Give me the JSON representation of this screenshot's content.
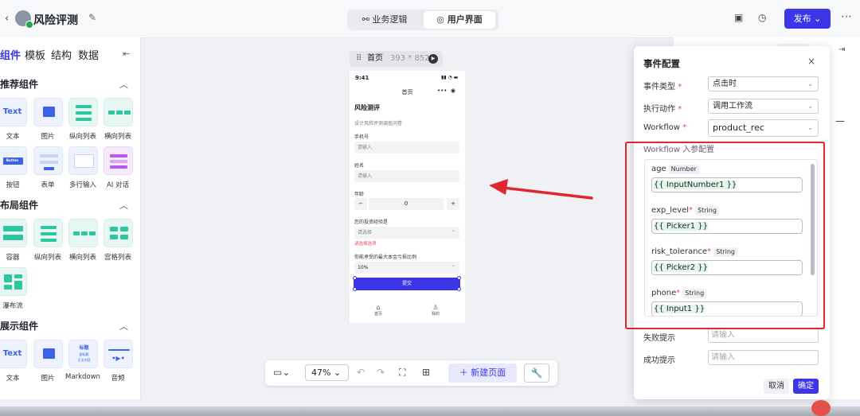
{
  "app": {
    "title": "风险评测"
  },
  "header": {
    "seg_logic": "业务逻辑",
    "seg_ui": "用户界面",
    "publish": "发布"
  },
  "left": {
    "tabs": [
      "组件",
      "模板",
      "结构",
      "数据"
    ],
    "sections": {
      "recommend": "推荐组件",
      "layout": "布局组件",
      "display": "展示组件"
    },
    "recommend_items": [
      "文本",
      "图片",
      "纵向列表",
      "横向列表",
      "按钮",
      "表单",
      "多行输入",
      "AI 对话"
    ],
    "layout_items": [
      "容器",
      "纵向列表",
      "横向列表",
      "宫格列表",
      "瀑布流"
    ],
    "display_items": [
      "文本",
      "图片",
      "Markdown",
      "音频"
    ],
    "tile_text": "Text",
    "button_tile": "Button",
    "md_tile": [
      "标题",
      "副标题",
      "正文内容"
    ]
  },
  "canvas": {
    "page_name": "首页",
    "page_size": "393 * 852",
    "zoom": "47%",
    "new_page": "新建页面"
  },
  "phone": {
    "time": "9:41",
    "nav_title": "首页",
    "title": "风险测评",
    "subtitle": "设计风险评测调查问卷",
    "phone_label": "手机号",
    "phone_ph": "请输入",
    "name_label": "姓名",
    "name_ph": "请输入",
    "age_label": "年龄",
    "step_minus": "−",
    "step_value": "0",
    "step_plus": "+",
    "exp_label": "您的投资经验是",
    "exp_ph": "请选择",
    "exp_error": "请选择选项",
    "risk_label": "你能承受的最大本金亏损比例",
    "risk_value": "10%",
    "submit": "提交",
    "tab_home": "首页",
    "tab_me": "我的"
  },
  "modal": {
    "title": "事件配置",
    "event_type_label": "事件类型",
    "event_type_value": "点击时",
    "action_label": "执行动作",
    "action_value": "调用工作流",
    "workflow_label": "Workflow",
    "workflow_value": "product_rec",
    "params_title": "Workflow 入参配置",
    "params": [
      {
        "name": "age",
        "required": "",
        "type": "Number",
        "value": "{{ InputNumber1 }}"
      },
      {
        "name": "exp_level",
        "required": "*",
        "type": "String",
        "value": "{{ Picker1 }}"
      },
      {
        "name": "risk_tolerance",
        "required": "*",
        "type": "String",
        "value": "{{ Picker2 }}"
      },
      {
        "name": "phone",
        "required": "*",
        "type": "String",
        "value": "{{ Input1 }}"
      }
    ],
    "fail_label": "失败提示",
    "fail_ph": "请输入",
    "success_label": "成功提示",
    "success_ph": "请输入",
    "cancel": "取消",
    "confirm": "确定"
  },
  "colors": {
    "accent": "#3c36e8",
    "highlight": "#e0262e",
    "teal": "#2ec6a0"
  }
}
